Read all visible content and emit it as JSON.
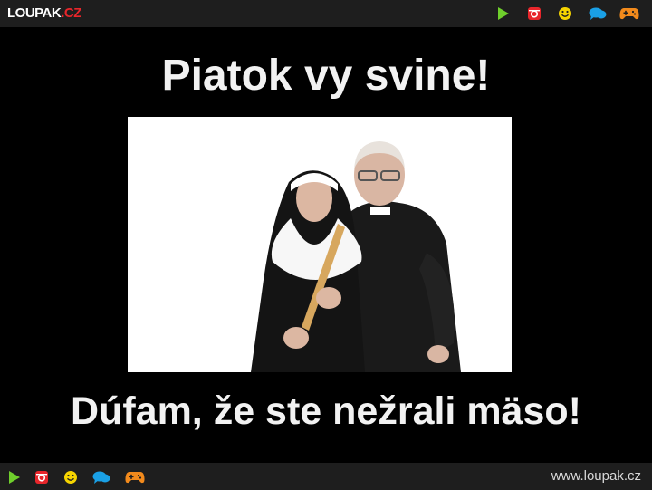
{
  "header": {
    "logo_main": "LOUPAK",
    "logo_tld": ".CZ",
    "icons": [
      "play-icon",
      "instagram-icon",
      "smiley-icon",
      "chat-icon",
      "gamepad-icon"
    ]
  },
  "meme": {
    "top_text": "Piatok vy svine!",
    "bottom_text": "Dúfam, že ste nežrali mäso!"
  },
  "footer": {
    "site_url": "www.loupak.cz"
  },
  "colors": {
    "bar_bg": "#1e1e1e",
    "play": "#6fcf2c",
    "instagram": "#e8262b",
    "smiley": "#f6d400",
    "chat": "#1aa0e6",
    "gamepad": "#f28a1c"
  }
}
